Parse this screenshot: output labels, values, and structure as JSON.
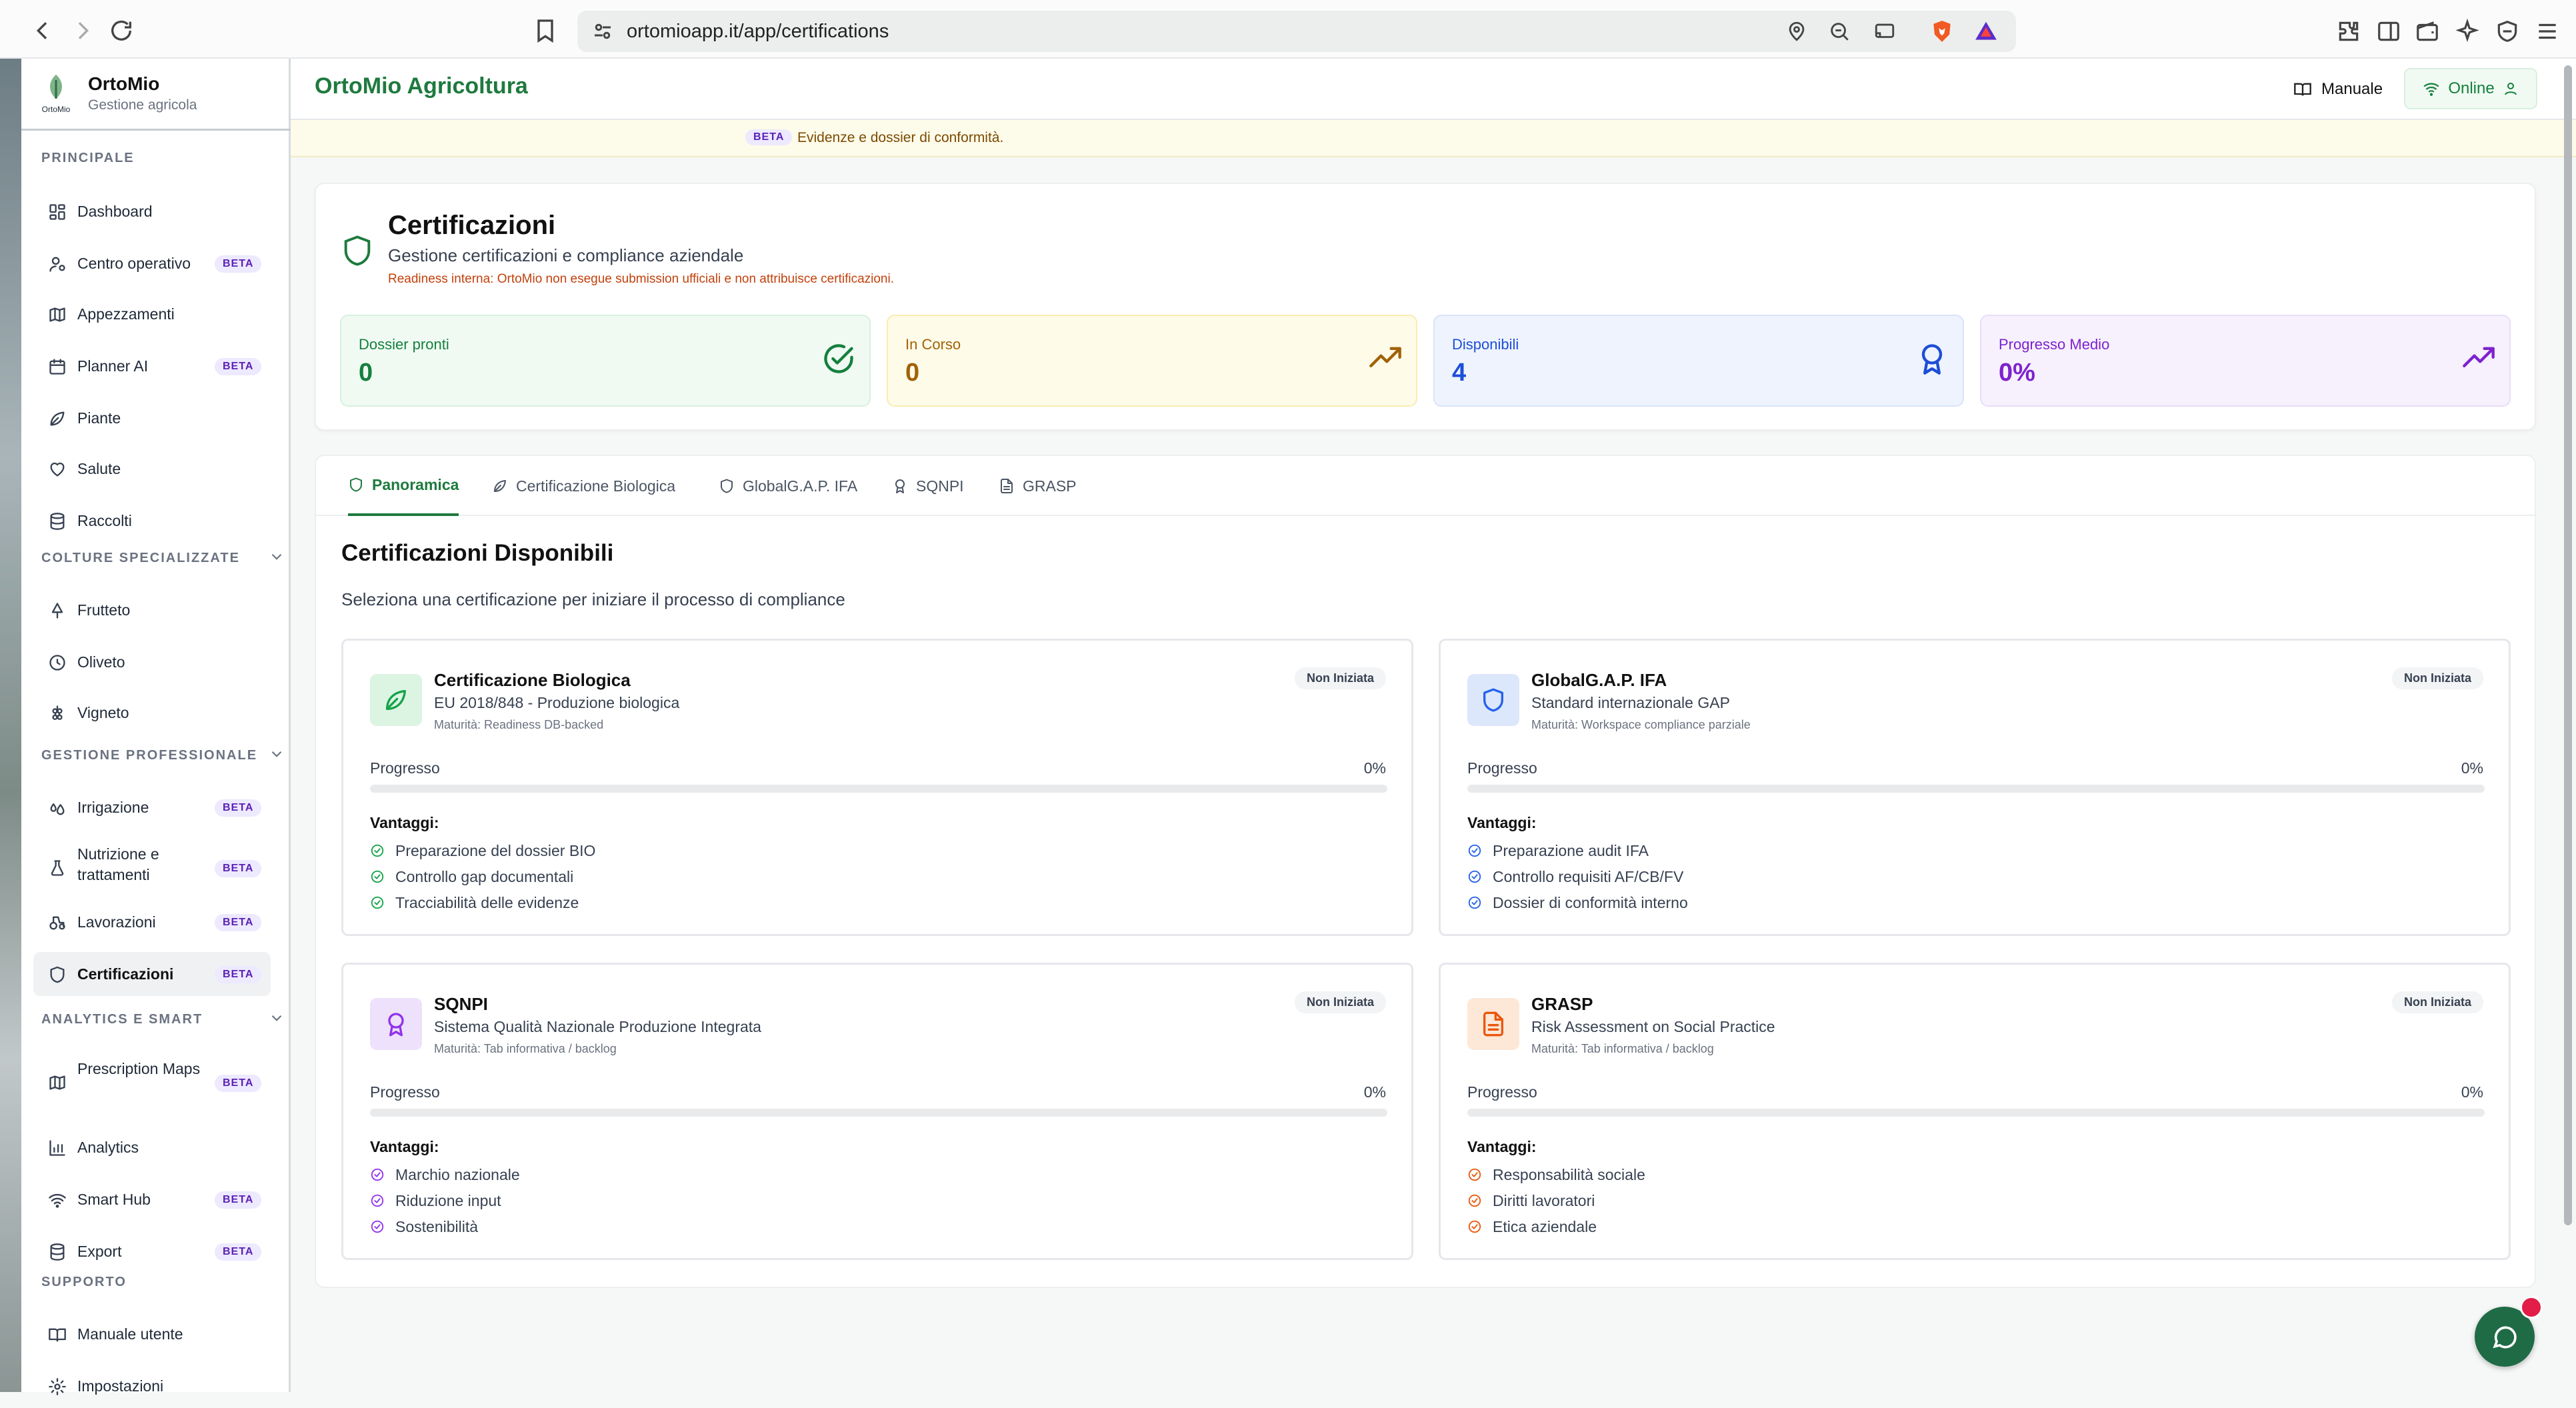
{
  "browser": {
    "url": "ortomioapp.it/app/certifications"
  },
  "brand": {
    "name": "OrtoMio",
    "subtitle": "Gestione agricola",
    "logo_text": "OrtoMio"
  },
  "sidebar": {
    "beta_label": "BETA",
    "sections": [
      {
        "title": "PRINCIPALE",
        "items": [
          {
            "label": "Dashboard",
            "icon": "dashboard-icon",
            "beta": false
          },
          {
            "label": "Centro operativo",
            "icon": "user-cog-icon",
            "beta": true
          },
          {
            "label": "Appezzamenti",
            "icon": "map-icon",
            "beta": false
          },
          {
            "label": "Planner AI",
            "icon": "calendar-icon",
            "beta": true
          },
          {
            "label": "Piante",
            "icon": "leaf-icon",
            "beta": false
          },
          {
            "label": "Salute",
            "icon": "heart-icon",
            "beta": false
          },
          {
            "label": "Raccolti",
            "icon": "database-icon",
            "beta": false
          }
        ]
      },
      {
        "title": "COLTURE SPECIALIZZATE",
        "items": [
          {
            "label": "Frutteto",
            "icon": "tree-icon",
            "beta": false
          },
          {
            "label": "Oliveto",
            "icon": "olive-icon",
            "beta": false
          },
          {
            "label": "Vigneto",
            "icon": "grape-icon",
            "beta": false
          }
        ]
      },
      {
        "title": "GESTIONE PROFESSIONALE",
        "items": [
          {
            "label": "Irrigazione",
            "icon": "droplets-icon",
            "beta": true
          },
          {
            "label": "Nutrizione e trattamenti",
            "icon": "flask-icon",
            "beta": true
          },
          {
            "label": "Lavorazioni",
            "icon": "tractor-icon",
            "beta": true
          },
          {
            "label": "Certificazioni",
            "icon": "shield-icon",
            "beta": true
          }
        ]
      },
      {
        "title": "ANALYTICS E SMART",
        "items": [
          {
            "label": "Prescription Maps",
            "icon": "map-icon",
            "beta": true
          },
          {
            "label": "Analytics",
            "icon": "bar-chart-icon",
            "beta": false
          },
          {
            "label": "Smart Hub",
            "icon": "wifi-icon",
            "beta": true
          },
          {
            "label": "Export",
            "icon": "database-icon",
            "beta": true
          }
        ]
      },
      {
        "title": "SUPPORTO",
        "items": [
          {
            "label": "Manuale utente",
            "icon": "book-icon",
            "beta": false
          },
          {
            "label": "Impostazioni",
            "icon": "gear-icon",
            "beta": false
          }
        ]
      }
    ]
  },
  "header": {
    "title": "OrtoMio Agricoltura",
    "manual_label": "Manuale",
    "status_label": "Online"
  },
  "banner": {
    "badge": "BETA",
    "text": "Evidenze e dossier di conformità."
  },
  "hero": {
    "title": "Certificazioni",
    "subtitle": "Gestione certificazioni e compliance aziendale",
    "note": "Readiness interna: OrtoMio non esegue submission ufficiali e non attribuisce certificazioni.",
    "stats": [
      {
        "label": "Dossier pronti",
        "value": "0",
        "color": "#15803d",
        "bg": "#f0faf3",
        "border": "#d7f0df",
        "icon": "check-circle-icon"
      },
      {
        "label": "In Corso",
        "value": "0",
        "color": "#a16207",
        "bg": "#fefbe8",
        "border": "#f7edb4",
        "icon": "trending-up-icon"
      },
      {
        "label": "Disponibili",
        "value": "4",
        "color": "#1d4ed8",
        "bg": "#eef3fd",
        "border": "#d9e4fa",
        "icon": "award-icon"
      },
      {
        "label": "Progresso Medio",
        "value": "0%",
        "color": "#7e22ce",
        "bg": "#f6f1fd",
        "border": "#e9ddf9",
        "icon": "trending-up-icon"
      }
    ]
  },
  "tabs": [
    {
      "label": "Panoramica",
      "icon": "shield-icon",
      "active": true
    },
    {
      "label": "Certificazione Biologica",
      "icon": "leaf-icon",
      "active": false
    },
    {
      "label": "GlobalG.A.P. IFA",
      "icon": "shield-icon",
      "active": false
    },
    {
      "label": "SQNPI",
      "icon": "award-icon",
      "active": false
    },
    {
      "label": "GRASP",
      "icon": "file-icon",
      "active": false
    }
  ],
  "section": {
    "title": "Certificazioni Disponibili",
    "subtitle": "Seleziona una certificazione per iniziare il processo di compliance",
    "progress_label": "Progresso",
    "benefits_label": "Vantaggi:"
  },
  "certifications": [
    {
      "title": "Certificazione Biologica",
      "subtitle": "EU 2018/848 - Produzione biologica",
      "maturity": "Maturità: Readiness DB-backed",
      "status": "Non Iniziata",
      "progress": "0%",
      "progress_value": 0,
      "icon": "leaf-icon",
      "accent": "#16a34a",
      "icon_bg": "#dcf5e3",
      "benefits": [
        "Preparazione del dossier BIO",
        "Controllo gap documentali",
        "Tracciabilità delle evidenze"
      ]
    },
    {
      "title": "GlobalG.A.P. IFA",
      "subtitle": "Standard internazionale GAP",
      "maturity": "Maturità: Workspace compliance parziale",
      "status": "Non Iniziata",
      "progress": "0%",
      "progress_value": 0,
      "icon": "shield-icon",
      "accent": "#2563eb",
      "icon_bg": "#dde7fb",
      "benefits": [
        "Preparazione audit IFA",
        "Controllo requisiti AF/CB/FV",
        "Dossier di conformità interno"
      ]
    },
    {
      "title": "SQNPI",
      "subtitle": "Sistema Qualità Nazionale Produzione Integrata",
      "maturity": "Maturità: Tab informativa / backlog",
      "status": "Non Iniziata",
      "progress": "0%",
      "progress_value": 0,
      "icon": "award-icon",
      "accent": "#9333ea",
      "icon_bg": "#ede1fb",
      "benefits": [
        "Marchio nazionale",
        "Riduzione input",
        "Sostenibilità"
      ]
    },
    {
      "title": "GRASP",
      "subtitle": "Risk Assessment on Social Practice",
      "maturity": "Maturità: Tab informativa / backlog",
      "status": "Non Iniziata",
      "progress": "0%",
      "progress_value": 0,
      "icon": "file-icon",
      "accent": "#ea580c",
      "icon_bg": "#fde8d7",
      "benefits": [
        "Responsabilità sociale",
        "Diritti lavoratori",
        "Etica aziendale"
      ]
    }
  ]
}
